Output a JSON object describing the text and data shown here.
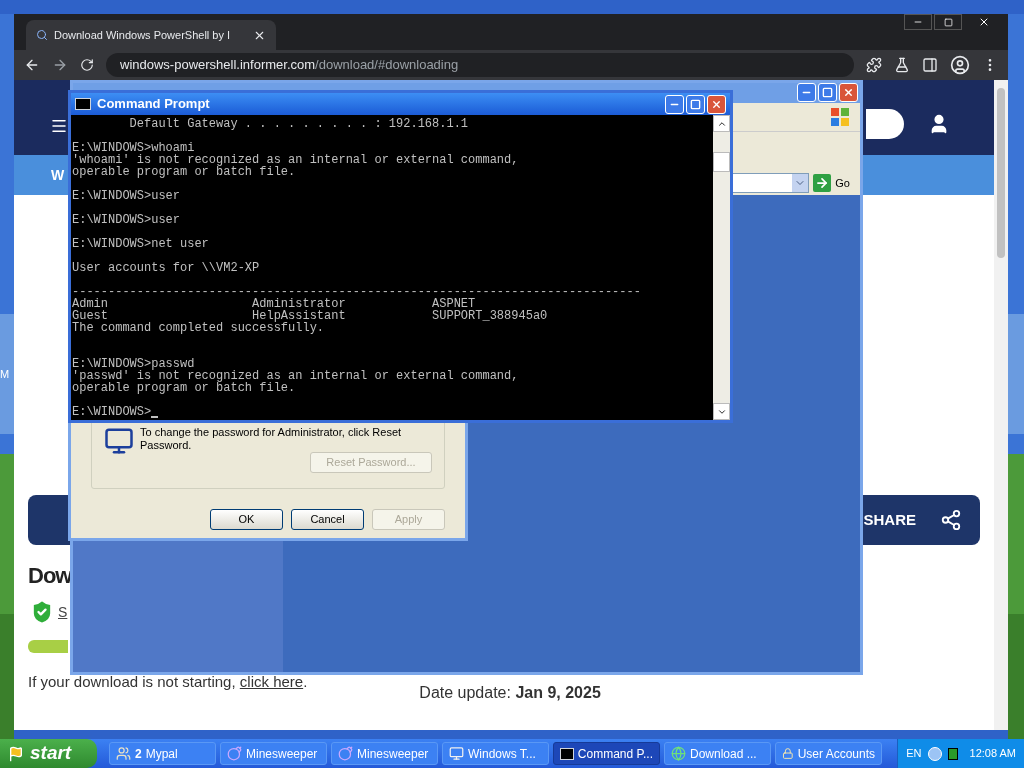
{
  "desktop": {
    "label": "M"
  },
  "browser": {
    "tab_title": "Download Windows PowerShell by I",
    "url_host": "windows-powershell.informer.com",
    "url_path": "/download/#downloading",
    "page": {
      "nav_text": "W",
      "share": "SHARE",
      "heading": "Dow",
      "publisher": "S",
      "download_note": "If your download is not starting,",
      "link": "click here",
      "link_end": ".",
      "date": "Date update: **Jan 9, 2025**"
    }
  },
  "explorer": {
    "go": "Go"
  },
  "dialog": {
    "message": "To change the password for Administrator, click Reset Password.",
    "reset": {
      "label": "Reset Password...",
      "disabled": true
    },
    "buttons": [
      {
        "label": "OK",
        "disabled": false
      },
      {
        "label": "Cancel",
        "disabled": false
      },
      {
        "label": "Apply",
        "disabled": true
      }
    ]
  },
  "console": {
    "title": "Command Prompt",
    "prompt": "E:\\WINDOWS>",
    "blocks": [
      [
        "        Default Gateway . . . . . . . . . : 192.168.1.1"
      ],
      [
        "E:\\WINDOWS>whoami",
        "'whoami' is not recognized as an internal or external command,",
        "operable program or batch file."
      ],
      [
        "E:\\WINDOWS>user"
      ],
      [
        "E:\\WINDOWS>user"
      ],
      [
        "E:\\WINDOWS>net user"
      ],
      [
        "User accounts for \\\\VM2-XP"
      ],
      [
        "-------------------------------------------------------------------------------",
        "Admin                    Administrator            ASPNET",
        "Guest                    HelpAssistant            SUPPORT_388945a0",
        "The command completed successfully."
      ],
      [
        "E:\\WINDOWS>passwd",
        "'passwd' is not recognized as an internal or external command,",
        "operable program or batch file."
      ]
    ]
  },
  "taskbar": {
    "start": "start",
    "items": [
      {
        "kind": "group",
        "count": "2",
        "label": "Mypal",
        "selected": false
      },
      {
        "kind": "mine",
        "label": "Minesweeper",
        "selected": false
      },
      {
        "kind": "mine",
        "label": "Minesweeper",
        "selected": false
      },
      {
        "kind": "computer",
        "label": "Windows T...",
        "selected": false
      },
      {
        "kind": "cmd",
        "label": "Command P...",
        "selected": true
      },
      {
        "kind": "globe",
        "label": "Download ...",
        "selected": false
      },
      {
        "kind": "users",
        "label": "User Accounts",
        "selected": false
      }
    ],
    "language": "EN",
    "clock": "12:08 AM"
  }
}
